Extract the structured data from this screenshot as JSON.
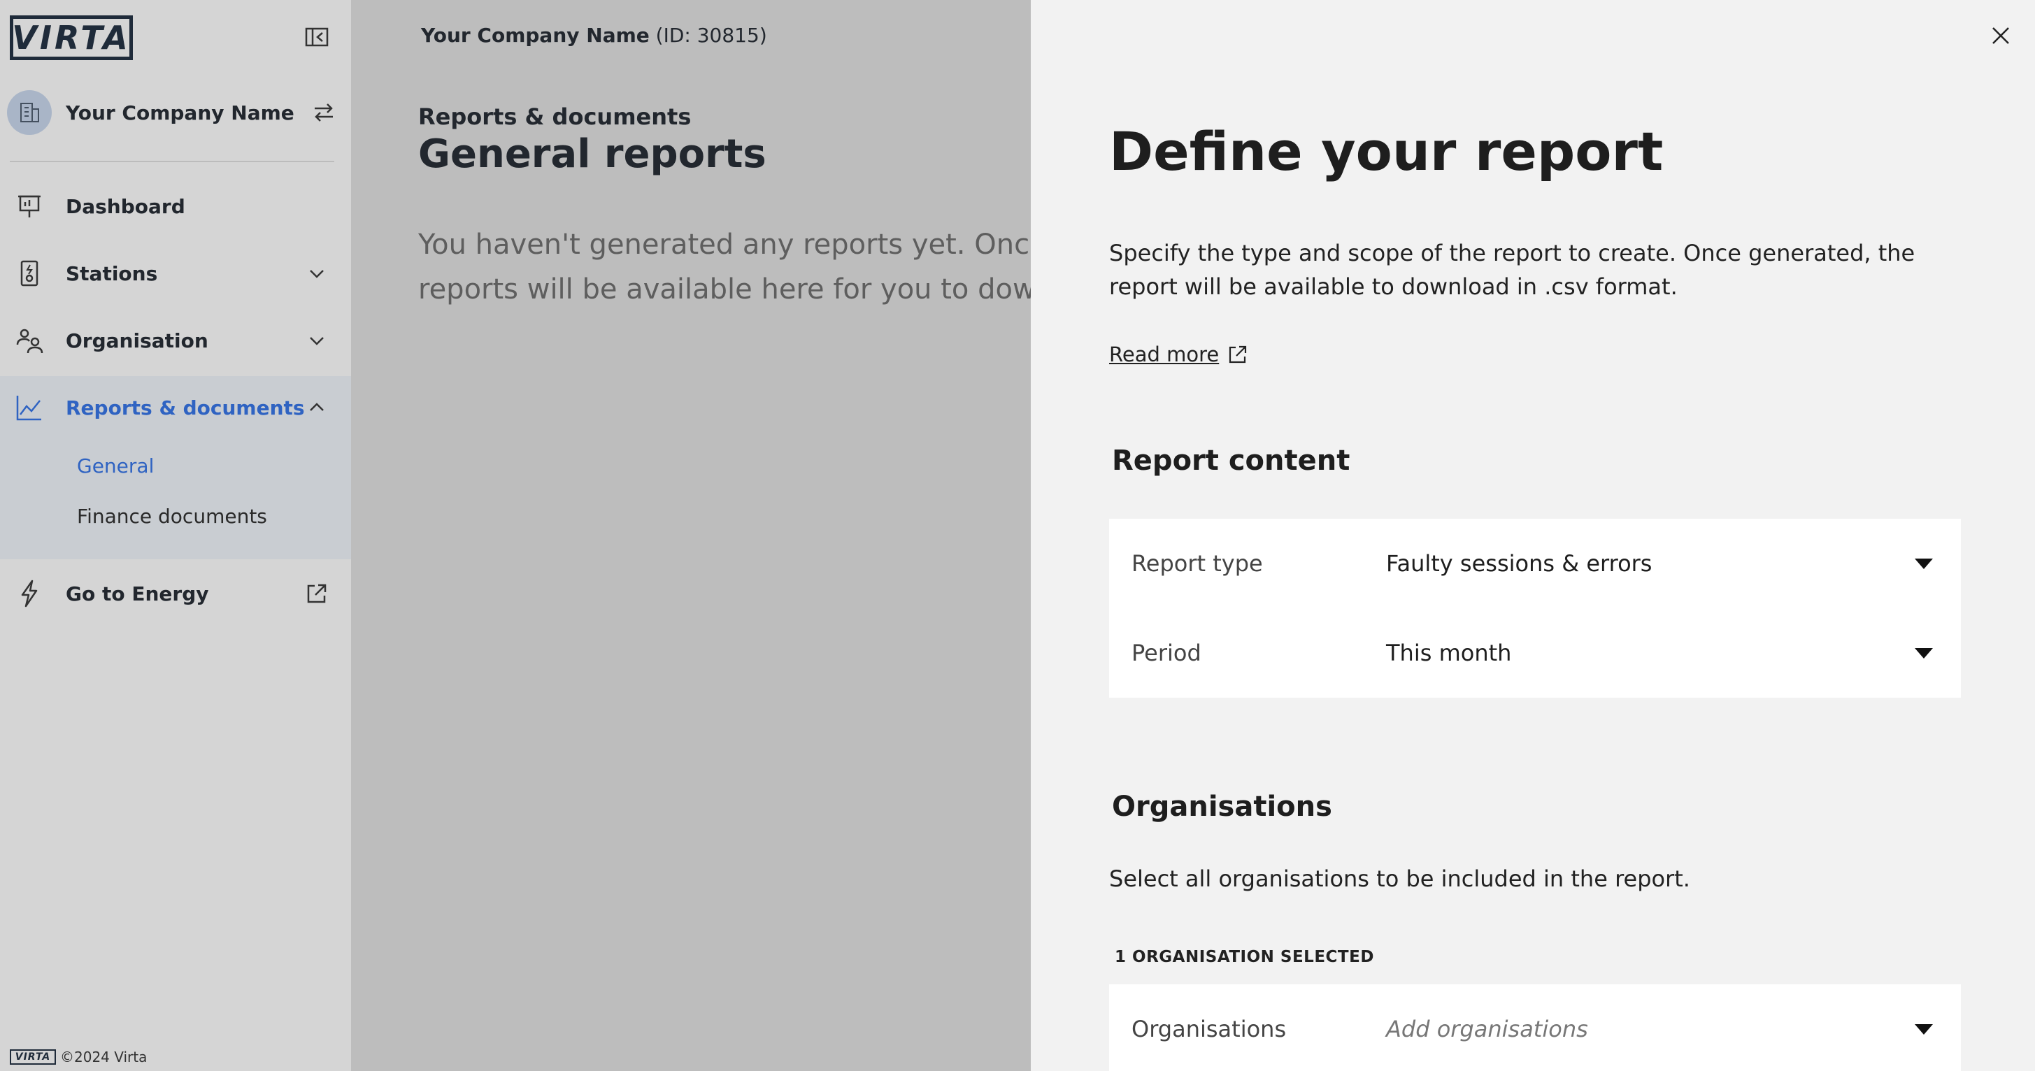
{
  "sidebar": {
    "logo_text": "VIRTA",
    "company_name": "Your Company Name",
    "nav": {
      "dashboard": "Dashboard",
      "stations": "Stations",
      "organisation": "Organisation",
      "reports": "Reports & documents",
      "energy": "Go to Energy"
    },
    "sub_items": {
      "general": "General",
      "finance": "Finance documents"
    },
    "footer": {
      "mini_logo": "VIRTA",
      "copyright": "©2024 Virta"
    },
    "icons": [
      "collapse-sidebar-icon",
      "building-icon",
      "swap-icon",
      "presentation-icon",
      "charging-station-icon",
      "users-icon",
      "chart-line-icon",
      "lightning-icon",
      "external-link-icon",
      "chevron-down-icon",
      "chevron-up-icon"
    ]
  },
  "main": {
    "company_name": "Your Company Name",
    "company_id": " (ID: 30815)",
    "breadcrumb": "Reports & documents",
    "title": "General reports",
    "empty_message": "You haven't generated any reports yet. Once generated, reports will be available here for you to download."
  },
  "drawer": {
    "title": "Define your report",
    "description": "Specify the type and scope of the report to create. Once generated, the report will be available to download in .csv format.",
    "read_more": "Read more",
    "report_content": {
      "heading": "Report content",
      "report_type_label": "Report type",
      "report_type_value": "Faulty sessions & errors",
      "period_label": "Period",
      "period_value": "This month"
    },
    "organisations": {
      "heading": "Organisations",
      "description": "Select all organisations to be included in the report.",
      "selected_count": "1 ORGANISATION SELECTED",
      "field_label": "Organisations",
      "field_placeholder": "Add organisations"
    }
  },
  "colors": {
    "accent": "#2f63c2",
    "sidebar_bg": "#d5d5d5",
    "overlay_bg": "#bdbdbd",
    "drawer_bg": "#f2f2f2"
  }
}
